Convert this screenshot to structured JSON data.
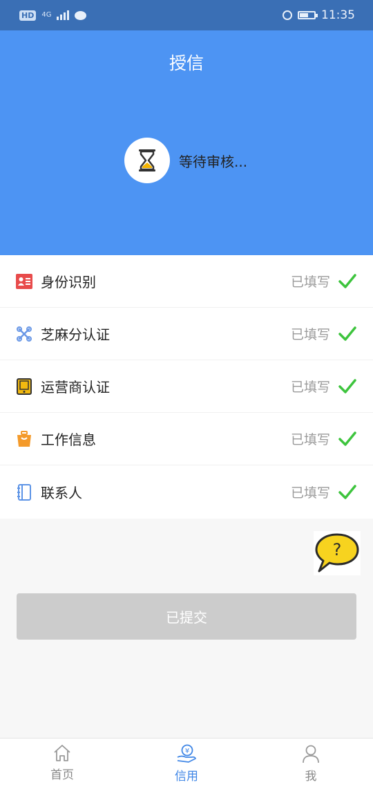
{
  "status_bar": {
    "hd": "HD",
    "network": "4G",
    "time": "11:35"
  },
  "header": {
    "title": "授信",
    "review_status": "等待审核..."
  },
  "items": [
    {
      "label": "身份识别",
      "status": "已填写",
      "icon": "id-card-icon",
      "color": "#e84b4b"
    },
    {
      "label": "芝麻分认证",
      "status": "已填写",
      "icon": "sesame-icon",
      "color": "#6a98e6"
    },
    {
      "label": "运营商认证",
      "status": "已填写",
      "icon": "phone-icon",
      "color": "#f2b90f"
    },
    {
      "label": "工作信息",
      "status": "已填写",
      "icon": "briefcase-icon",
      "color": "#f49a2a"
    },
    {
      "label": "联系人",
      "status": "已填写",
      "icon": "contacts-book-icon",
      "color": "#5c93e6"
    }
  ],
  "submit_button": {
    "label": "已提交"
  },
  "help": {
    "symbol": "?"
  },
  "tabs": [
    {
      "label": "首页",
      "icon": "home-icon",
      "active": false
    },
    {
      "label": "信用",
      "icon": "credit-icon",
      "active": true
    },
    {
      "label": "我",
      "icon": "user-icon",
      "active": false
    }
  ],
  "colors": {
    "accent": "#4d94f3",
    "status_bar": "#3a6fb5",
    "check": "#3dc43d",
    "disabled_button": "#cccccc",
    "active_tab": "#3f86e6"
  }
}
